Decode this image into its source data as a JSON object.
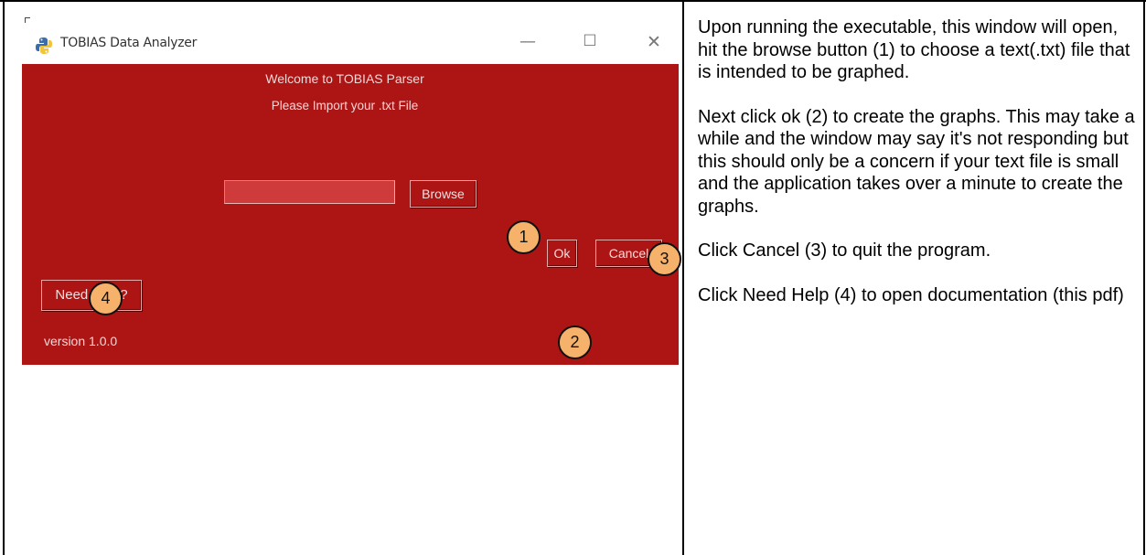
{
  "app_window": {
    "title": "TOBIAS Data Analyzer",
    "window_controls": {
      "minimize": "—",
      "maximize": "☐",
      "close": "✕"
    },
    "welcome_text": "Welcome to TOBIAS Parser",
    "import_prompt": "Please Import your .txt File",
    "file_path_value": "",
    "browse_label": "Browse",
    "ok_label": "Ok",
    "cancel_label": "Cancel",
    "help_label": "Need Help?",
    "version_text": "version 1.0.0",
    "background_color": "#ad1414"
  },
  "callouts": {
    "browse": "1",
    "ok": "2",
    "cancel": "3",
    "help": "4"
  },
  "callout_color": "#f6b26b",
  "instructions": [
    "Upon running the executable, this window will open, hit the browse button (1) to choose a text(.txt) file that is intended to be graphed.",
    "Next click ok (2) to create the graphs. This may take a while and the window may say it's not responding but this should only be a concern if your text file is small and the application takes over a minute to create the graphs.",
    "Click Cancel (3) to quit the program.",
    "Click Need Help (4) to open documentation (this pdf)"
  ]
}
